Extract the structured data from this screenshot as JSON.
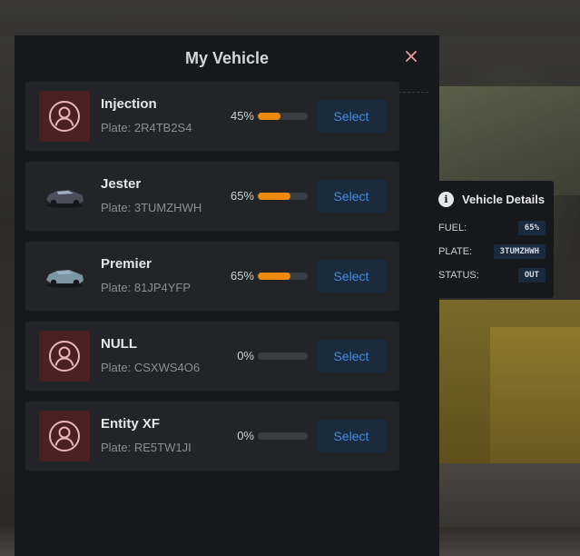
{
  "panel": {
    "title": "My Vehicle",
    "close_icon": "close-icon"
  },
  "vehicles": [
    {
      "name": "Injection",
      "plate": "Plate: 2R4TB2S4",
      "fuel": 45,
      "fuel_label": "45%",
      "thumb": "placeholder-car-icon",
      "select_label": "Select"
    },
    {
      "name": "Jester",
      "plate": "Plate: 3TUMZHWH",
      "fuel": 65,
      "fuel_label": "65%",
      "thumb": "car-image",
      "select_label": "Select"
    },
    {
      "name": "Premier",
      "plate": "Plate: 81JP4YFP",
      "fuel": 65,
      "fuel_label": "65%",
      "thumb": "car-image",
      "select_label": "Select"
    },
    {
      "name": "NULL",
      "plate": "Plate: CSXWS4O6",
      "fuel": 0,
      "fuel_label": "0%",
      "thumb": "placeholder-car-icon",
      "select_label": "Select"
    },
    {
      "name": "Entity XF",
      "plate": "Plate: RE5TW1JI",
      "fuel": 0,
      "fuel_label": "0%",
      "thumb": "placeholder-car-icon",
      "select_label": "Select"
    }
  ],
  "details": {
    "title": "Vehicle Details",
    "icon": "info-icon",
    "fuel_label": "FUEL:",
    "fuel_value": "65%",
    "plate_label": "PLATE:",
    "plate_value": "3TUMZHWH",
    "status_label": "STATUS:",
    "status_value": "OUT"
  },
  "colors": {
    "accent": "#3d8fe0",
    "fuel_fill": "#f08a14",
    "placeholder_bg": "#4a2022",
    "panel_bg": "#17181b",
    "row_bg": "#232428"
  }
}
